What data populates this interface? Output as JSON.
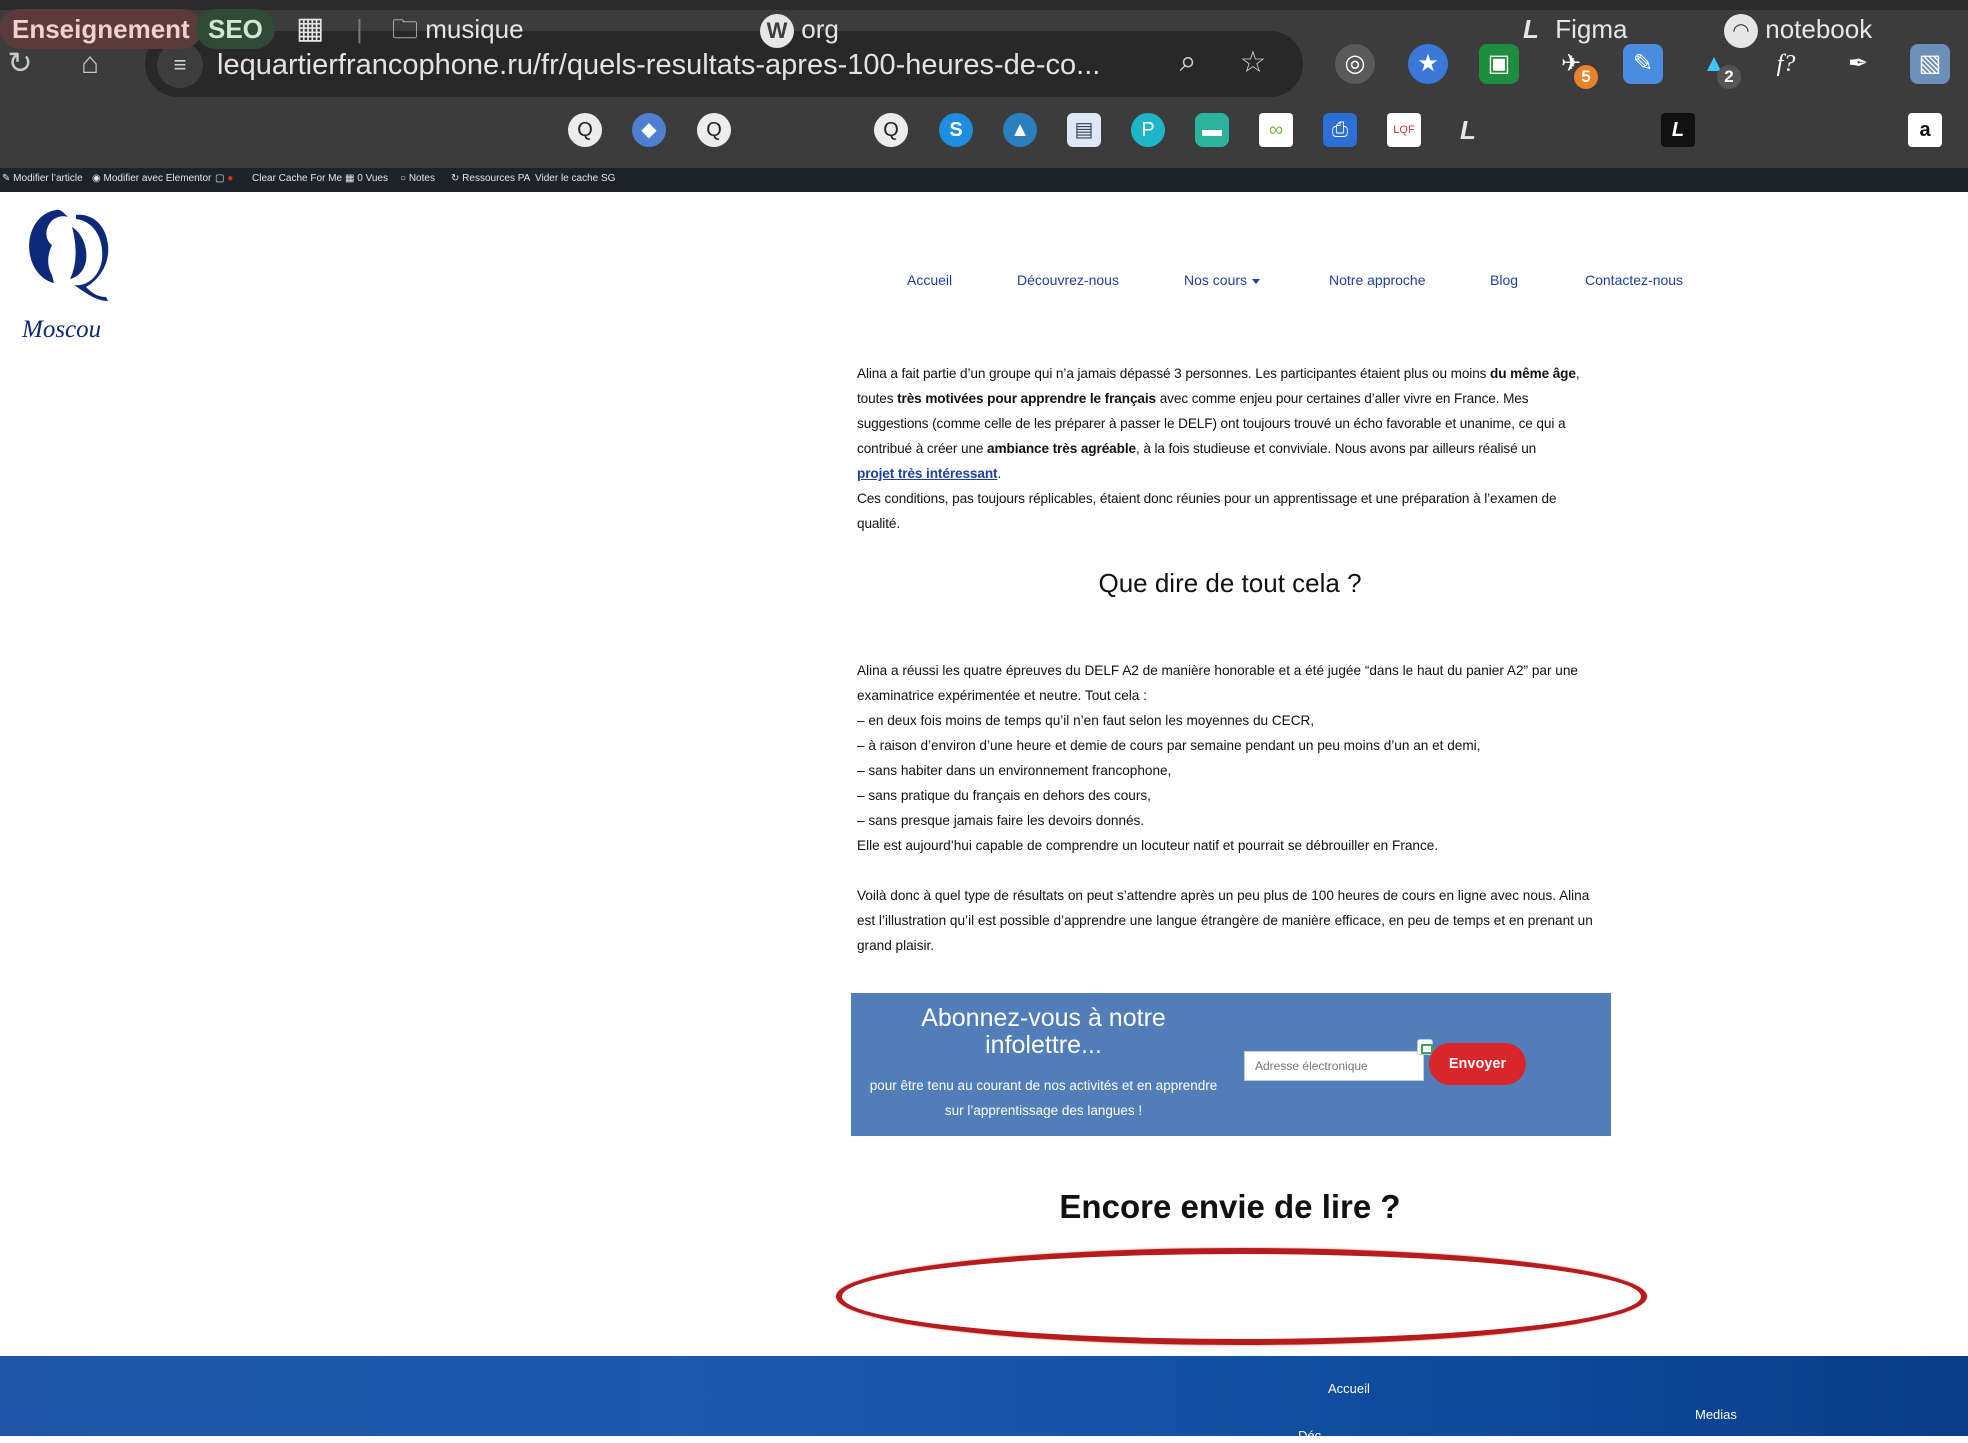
{
  "browser": {
    "url": "lequartierfrancophone.ru/fr/quels-resultats-apres-100-heures-de-co...",
    "extensions": [
      {
        "icon": "globe-icon",
        "badge": ""
      },
      {
        "icon": "star-badge-icon",
        "badge": ""
      },
      {
        "icon": "robot-face-icon",
        "badge": ""
      },
      {
        "icon": "bird-icon",
        "badge": "5"
      },
      {
        "icon": "edit-square-icon",
        "badge": ""
      },
      {
        "icon": "ghost-icon",
        "badge": "2"
      },
      {
        "icon": "font-query-icon",
        "label": "f?"
      },
      {
        "icon": "eyedropper-icon",
        "badge": ""
      },
      {
        "icon": "image-viewer-icon",
        "badge": ""
      }
    ]
  },
  "bookmarks": {
    "enseignement": "Enseignement",
    "seo": "SEO",
    "musique": "musique",
    "org": "org",
    "figma": "Figma",
    "notebook": "notebook"
  },
  "adminbar": {
    "items": [
      "Modifier l’article",
      "Modifier avec Elementor",
      "Clear Cache For Me",
      "0 Vues",
      "Notes",
      "Ressources PA",
      "Vider le cache SG"
    ]
  },
  "site": {
    "logo_text": "Moscou",
    "nav": {
      "accueil": "Accueil",
      "decouvrez": "Découvrez-nous",
      "cours": "Nos cours",
      "approche": "Notre approche",
      "blog": "Blog",
      "contact": "Contactez-nous"
    }
  },
  "article": {
    "p1_a": "Alina a fait partie d’un groupe qui n’a jamais dépassé 3 personnes. Les participantes étaient plus ou moins ",
    "p1_b1": "du même âge",
    "p1_c": ", toutes ",
    "p1_b2": "très motivées pour apprendre le français",
    "p1_d": " avec comme enjeu pour certaines d’aller vivre en France. Mes suggestions (comme celle de les préparer à passer le DELF) ont toujours trouvé un écho favorable et unanime, ce qui a contribué à créer une ",
    "p1_b3": "ambiance très agréable",
    "p1_e": ", à la fois studieuse et conviviale. Nous avons par ailleurs réalisé un ",
    "p1_link": "projet très intéressant",
    "p1_f": ".",
    "p2": "Ces conditions, pas toujours réplicables, étaient donc réunies pour un apprentissage et une préparation à l’examen de qualité.",
    "heading": "Que dire de tout cela ?",
    "p3": "Alina a réussi les quatre épreuves du DELF A2 de manière honorable et a été jugée “dans le haut du panier A2” par une examinatrice expérimentée et neutre. Tout cela :",
    "list": [
      "– en deux fois moins de temps qu’il n’en faut selon les moyennes du CECR,",
      "– à raison d’environ d’une heure et demie de cours par semaine pendant un peu moins d’un an et demi,",
      "– sans habiter dans un environnement francophone,",
      "– sans pratique du français en dehors des cours,",
      "– sans presque jamais faire les devoirs donnés."
    ],
    "p4": "Elle est aujourd’hui capable de comprendre un locuteur natif et pourrait se débrouiller en France.",
    "p5": "Voilà donc à quel type de résultats on peut s’attendre après un peu plus de 100 heures de cours en ligne avec nous. Alina est l’illustration qu’il est possible d’apprendre une langue étrangère de manière efficace, en peu de temps et en prenant un grand plaisir."
  },
  "newsletter": {
    "title": "Abonnez-vous à notre infolettre...",
    "description": "pour être tenu au courant de nos activités et en apprendre sur l’apprentissage des langues !",
    "placeholder": "Adresse électronique",
    "button": "Envoyer"
  },
  "more": {
    "heading": "Encore envie de lire ?"
  },
  "footer": {
    "accueil": "Accueil",
    "medias": "Medias",
    "partial": "Déc"
  },
  "colors": {
    "newsletter_bg": "#517db9",
    "button_red": "#d8262b",
    "nav_blue": "#1d3fa0",
    "annotation_red": "#b81b1b"
  }
}
